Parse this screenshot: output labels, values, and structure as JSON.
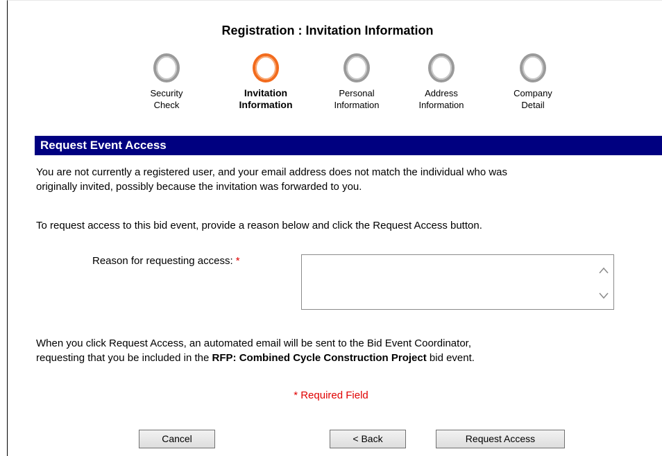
{
  "header": {
    "title": "Registration : Invitation Information"
  },
  "steps": [
    {
      "line1": "Security",
      "line2": "Check",
      "state": "inactive"
    },
    {
      "line1": "Invitation",
      "line2": "Information",
      "state": "active"
    },
    {
      "line1": "Personal",
      "line2": "Information",
      "state": "inactive"
    },
    {
      "line1": "Address",
      "line2": "Information",
      "state": "inactive"
    },
    {
      "line1": "Company",
      "line2": "Detail",
      "state": "inactive"
    }
  ],
  "colors": {
    "active_step": "#f26b1d",
    "inactive_step": "#9a9a9a",
    "section_bar": "#000080",
    "required": "#e00000"
  },
  "section": {
    "title": "Request Event Access"
  },
  "content": {
    "intro_line1": "You are not currently a registered user, and your email address does not match the individual who was",
    "intro_line2": "originally invited, possibly because the invitation was forwarded to you.",
    "instruction": "To request access to this bid event, provide a reason below and click the Request Access button.",
    "reason_label": "Reason for requesting access:",
    "required_marker": "*",
    "reason_value": "",
    "notice_line1": "When you click Request Access, an automated email will be sent to the Bid Event Coordinator,",
    "notice_line2_prefix": "requesting that you be included in the",
    "notice_event_name": "RFP: Combined Cycle Construction Project",
    "notice_line2_suffix": "bid event.",
    "required_field_note": "* Required Field"
  },
  "buttons": {
    "cancel": "Cancel",
    "back": "< Back",
    "request_access": "Request Access"
  }
}
